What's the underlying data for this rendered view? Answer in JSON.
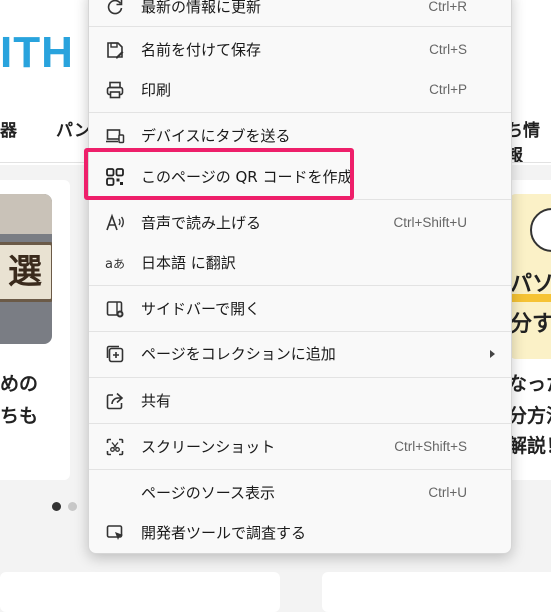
{
  "background_page": {
    "logo_text": "ITH",
    "nav": {
      "left": "器",
      "partial": "パン",
      "right": "ち情報"
    },
    "thumb_left_text": "選",
    "thumb_right_texts": [
      "パソ",
      "分す"
    ],
    "left_card_lines": [
      "めの",
      "ちも"
    ],
    "right_card_lines": [
      "なった",
      "分方法",
      "解説！"
    ],
    "carousel": {
      "total": 2,
      "active": 1
    }
  },
  "context_menu": {
    "items": [
      {
        "label": "最新の情報に更新",
        "shortcut": "Ctrl+R",
        "icon": "refresh-icon"
      },
      {
        "label": "名前を付けて保存",
        "shortcut": "Ctrl+S",
        "icon": "save-as-icon"
      },
      {
        "label": "印刷",
        "shortcut": "Ctrl+P",
        "icon": "print-icon"
      },
      {
        "label": "デバイスにタブを送る",
        "shortcut": "",
        "icon": "send-to-device-icon"
      },
      {
        "label": "このページの QR コードを作成",
        "shortcut": "",
        "icon": "qr-code-icon",
        "highlighted": true
      },
      {
        "label": "音声で読み上げる",
        "shortcut": "Ctrl+Shift+U",
        "icon": "read-aloud-icon"
      },
      {
        "label": "日本語 に翻訳",
        "shortcut": "",
        "icon": "translate-icon"
      },
      {
        "label": "サイドバーで開く",
        "shortcut": "",
        "icon": "sidebar-icon"
      },
      {
        "label": "ページをコレクションに追加",
        "shortcut": "",
        "icon": "collections-icon",
        "submenu": true
      },
      {
        "label": "共有",
        "shortcut": "",
        "icon": "share-icon"
      },
      {
        "label": "スクリーンショット",
        "shortcut": "Ctrl+Shift+S",
        "icon": "screenshot-icon"
      },
      {
        "label": "ページのソース表示",
        "shortcut": "Ctrl+U",
        "icon": ""
      },
      {
        "label": "開発者ツールで調査する",
        "shortcut": "",
        "icon": "inspect-icon"
      }
    ],
    "highlight_color": "#ee1f6a"
  }
}
